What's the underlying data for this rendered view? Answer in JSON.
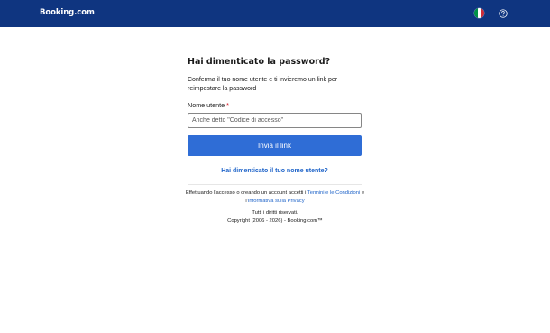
{
  "header": {
    "logo": "Booking.com",
    "flag_icon": "italy-flag-icon",
    "help_icon": "question-circle-icon",
    "background_color": "#0f3580"
  },
  "form": {
    "title": "Hai dimenticato la password?",
    "description": "Conferma il tuo nome utente e ti invieremo un link per reimpostare la password",
    "username_label": "Nome utente",
    "required_marker": "*",
    "username_placeholder": "Anche detto \"Codice di accesso\"",
    "username_value": "",
    "submit_label": "Invia il link",
    "forgot_username_link": "Hai dimenticato il tuo nome utente?",
    "accent_color": "#2f6dd6"
  },
  "footer": {
    "terms_prefix": "Effettuando l'accesso o creando un account accetti i",
    "terms_link": "Termini e le Condizioni",
    "terms_middle": "e l'",
    "privacy_link": "Informativa sulla Privacy",
    "rights": "Tutti i diritti riservati.",
    "copyright": "Copyright (2006 - 2026) - Booking.com™"
  }
}
